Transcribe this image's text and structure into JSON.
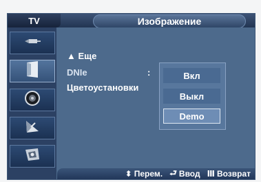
{
  "header": {
    "tab_label": "TV",
    "title": "Изображение"
  },
  "sidebar": {
    "items": [
      {
        "icon": "antenna-icon"
      },
      {
        "icon": "screen-icon"
      },
      {
        "icon": "speaker-icon"
      },
      {
        "icon": "satellite-dish-icon"
      },
      {
        "icon": "setup-icon"
      }
    ]
  },
  "menu": {
    "more_label": "▲ Еще",
    "dnie_label": "DNIe",
    "dnie_colon": ":",
    "color_label": "Цветоустановки"
  },
  "dropdown": {
    "options": [
      "Вкл",
      "Выкл",
      "Demo"
    ],
    "selected": "Demo"
  },
  "footer": {
    "move_icon": "⬍",
    "move_label": "Перем.",
    "enter_icon": "⮐",
    "enter_label": "Ввод",
    "return_icon": "Ⅲ",
    "return_label": "Возврат"
  },
  "colors": {
    "panel": "#4d6a8c",
    "header": "#223552",
    "highlight": "#6e8db5"
  }
}
